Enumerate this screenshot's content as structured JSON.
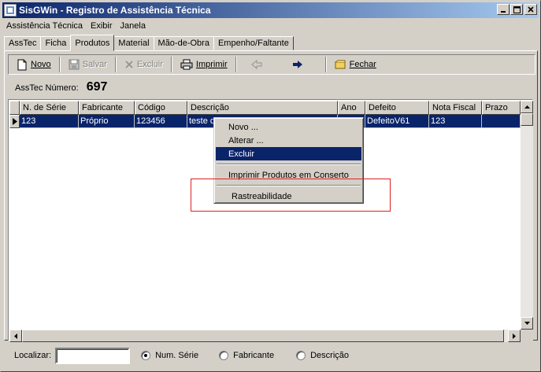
{
  "window": {
    "title": "SisGWin - Registro de Assistência Técnica",
    "title_app": "SisGWin",
    "title_rest": " - Registro de Assistência Técnica"
  },
  "menubar": [
    "Assistência Técnica",
    "Exibir",
    "Janela"
  ],
  "tabs": [
    {
      "label": "AssTec",
      "active": false
    },
    {
      "label": "Ficha",
      "active": false
    },
    {
      "label": "Produtos",
      "active": true
    },
    {
      "label": "Material",
      "active": false
    },
    {
      "label": "Mão-de-Obra",
      "active": false
    },
    {
      "label": "Empenho/Faltante",
      "active": false
    }
  ],
  "toolbar": {
    "novo": "Novo",
    "salvar": "Salvar",
    "excluir": "Excluir",
    "imprimir": "Imprimir",
    "fechar": "Fechar"
  },
  "asstec": {
    "label": "AssTec Número:",
    "number": "697"
  },
  "grid": {
    "columns": [
      "N. de Série",
      "Fabricante",
      "Código",
      "Descrição",
      "Ano",
      "Defeito",
      "Nota Fiscal",
      "Prazo"
    ],
    "rows": [
      [
        "123",
        "Próprio",
        "123456",
        "teste d",
        "",
        "DefeitoV61",
        "123",
        ""
      ]
    ]
  },
  "context_menu": {
    "items": [
      "Novo ...",
      "Alterar ...",
      "Excluir",
      "Imprimir Produtos em Conserto",
      "Rastreabilidade"
    ],
    "highlighted": "Excluir"
  },
  "bottom": {
    "localizar_label": "Localizar:",
    "search_value": "",
    "radios": [
      {
        "label": "Num. Série",
        "checked": true
      },
      {
        "label": "Fabricante",
        "checked": false
      },
      {
        "label": "Descrição",
        "checked": false
      }
    ]
  },
  "colors": {
    "titlebar_start": "#0a246a",
    "titlebar_end": "#a6caf0",
    "selection": "#0a246a",
    "face": "#d4d0c8",
    "annotation_red": "#e02020"
  }
}
